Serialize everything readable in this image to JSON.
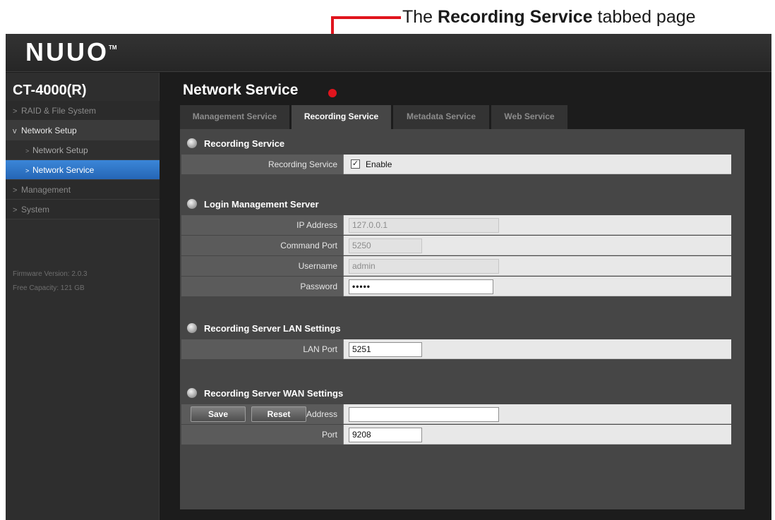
{
  "annotation": {
    "prefix": "The ",
    "emphasis": "Recording Service",
    "suffix": " tabbed page",
    "color": "#e0141d"
  },
  "brand": {
    "logo": "NUUO",
    "trademark": "TM"
  },
  "sidebar": {
    "device_name": "CT-4000(R)",
    "items": [
      {
        "label": "RAID & File System",
        "chevron": ">"
      },
      {
        "label": "Network Setup",
        "chevron": "v"
      },
      {
        "label": "Network Setup",
        "chevron": ">"
      },
      {
        "label": "Network Service",
        "chevron": ">"
      },
      {
        "label": "Management",
        "chevron": ">"
      },
      {
        "label": "System",
        "chevron": ">"
      }
    ],
    "firmware": "Firmware Version: 2.0.3",
    "capacity": "Free Capacity: 121 GB"
  },
  "page": {
    "title": "Network Service"
  },
  "tabs": [
    {
      "label": "Management Service"
    },
    {
      "label": "Recording Service"
    },
    {
      "label": "Metadata Service"
    },
    {
      "label": "Web Service"
    }
  ],
  "recording_service": {
    "header": "Recording Service",
    "label": "Recording Service",
    "checkbox_mark": "✓",
    "checkbox_label": "Enable"
  },
  "login_server": {
    "header": "Login Management Server",
    "ip_label": "IP Address",
    "ip_value": "127.0.0.1",
    "cmd_port_label": "Command Port",
    "cmd_port_value": "5250",
    "username_label": "Username",
    "username_value": "admin",
    "password_label": "Password",
    "password_value": "•••••"
  },
  "lan": {
    "header": "Recording Server LAN Settings",
    "port_label": "LAN Port",
    "port_value": "5251"
  },
  "wan": {
    "header": "Recording Server WAN Settings",
    "ip_label": "IP Address",
    "ip_value": "",
    "port_label": "Port",
    "port_value": "9208"
  },
  "buttons": {
    "save": "Save",
    "reset": "Reset"
  },
  "colors": {
    "accent_blue": "#2f76c8",
    "panel": "#464646",
    "background": "#1c1c1c"
  }
}
